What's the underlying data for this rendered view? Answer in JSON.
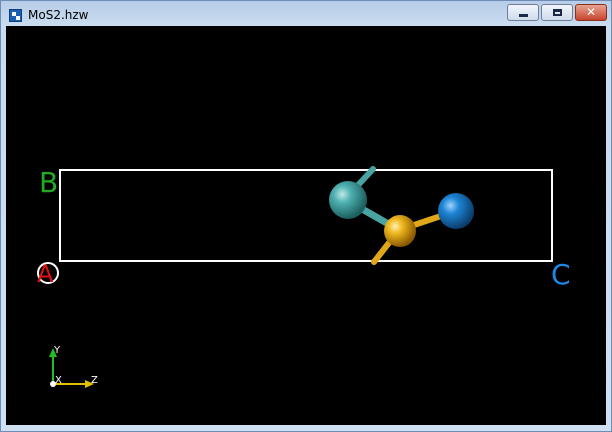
{
  "window": {
    "title": "MoS2.hzw",
    "controls": {
      "minimize": "minimize",
      "maximize": "maximize",
      "close": "close"
    }
  },
  "viewer": {
    "lattice_labels": {
      "a": "A",
      "b": "B",
      "c": "C"
    },
    "axis_labels": {
      "x": "X",
      "y": "Y",
      "z": "Z"
    },
    "colors": {
      "background": "#000000",
      "cell": "#ffffff",
      "label_a": "#e01010",
      "label_b": "#22aa22",
      "label_c": "#1e88e5",
      "atom_teal": "#3a9a9a",
      "atom_gold": "#e0a010",
      "atom_blue": "#1a78c2",
      "axis_y": "#20c020",
      "axis_z": "#e0c000"
    }
  }
}
